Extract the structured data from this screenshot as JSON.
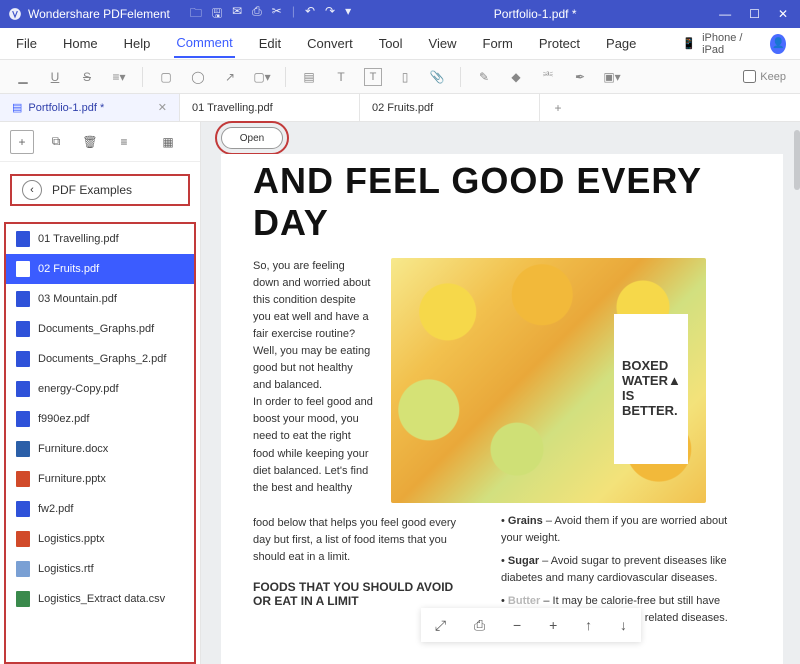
{
  "app_name": "Wondershare PDFelement",
  "doc_title": "Portfolio-1.pdf *",
  "menus": [
    "File",
    "Home",
    "Help",
    "Comment",
    "Edit",
    "Convert",
    "Tool",
    "View",
    "Form",
    "Protect",
    "Page"
  ],
  "active_menu": 3,
  "device_label": "iPhone / iPad",
  "keep_label": "Keep",
  "tabs": [
    {
      "label": "Portfolio-1.pdf *",
      "active": true,
      "icon": "pdf"
    },
    {
      "label": "01 Travelling.pdf",
      "active": false
    },
    {
      "label": "02 Fruits.pdf",
      "active": false
    }
  ],
  "breadcrumb_label": "PDF Examples",
  "open_label": "Open",
  "files": [
    {
      "name": "01 Travelling.pdf",
      "type": "pdf"
    },
    {
      "name": "02 Fruits.pdf",
      "type": "pdf",
      "selected": true
    },
    {
      "name": "03 Mountain.pdf",
      "type": "pdf"
    },
    {
      "name": "Documents_Graphs.pdf",
      "type": "pdf"
    },
    {
      "name": "Documents_Graphs_2.pdf",
      "type": "pdf"
    },
    {
      "name": "energy-Copy.pdf",
      "type": "pdf"
    },
    {
      "name": "f990ez.pdf",
      "type": "pdf"
    },
    {
      "name": "Furniture.docx",
      "type": "docx"
    },
    {
      "name": "Furniture.pptx",
      "type": "pptx"
    },
    {
      "name": "fw2.pdf",
      "type": "pdf"
    },
    {
      "name": "Logistics.pptx",
      "type": "pptx"
    },
    {
      "name": "Logistics.rtf",
      "type": "rtf"
    },
    {
      "name": "Logistics_Extract data.csv",
      "type": "csv"
    }
  ],
  "doc": {
    "title": "AND FEEL GOOD EVERY DAY",
    "para1": "So, you are feeling down and worried about this condition despite you eat well and have a fair exercise routine? Well, you may be eating good but not healthy and balanced.",
    "para2": "In order to feel good and boost your mood, you need to eat the right food while keeping your diet balanced. Let's find the best and healthy",
    "para3": "food below that helps you feel good every day but first, a list of food items that you should eat in a limit.",
    "h2": "FOODS THAT YOU SHOULD AVOID OR EAT IN A LIMIT",
    "bullet1_strong": "Grains",
    "bullet1_rest": " – Avoid them if you are worried about your weight.",
    "bullet2_strong": "Sugar",
    "bullet2_rest": " – Avoid sugar to prevent diseases like diabetes and many cardiovascular diseases.",
    "bullet3_strong": "Butter",
    "bullet3_rest": " – It may be calorie-free but still have connections with obesity and related diseases.",
    "box1": "BOXED",
    "box2": "WATER",
    "box3": "IS",
    "box4": "BETTER."
  }
}
